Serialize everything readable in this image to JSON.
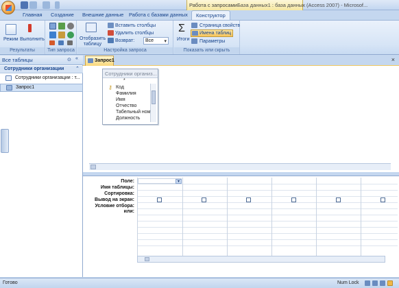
{
  "app": {
    "title": "База данных1 : база данных (Access 2007) - Microsof...",
    "context_tab_header": "Работа с запросами"
  },
  "tabs": [
    "Главная",
    "Создание",
    "Внешние данные",
    "Работа с базами данных",
    "Конструктор"
  ],
  "active_tab": "Конструктор",
  "ribbon": {
    "results": {
      "label": "Результаты",
      "view": "Режим",
      "run": "Выполнить"
    },
    "query_type": {
      "label": "Тип запроса"
    },
    "query_setup": {
      "label": "Настройка запроса",
      "show_table": "Отобразить таблицу",
      "insert_columns": "Вставить столбцы",
      "delete_columns": "Удалить столбцы",
      "return_label": "Возврат:",
      "return_value": "Все"
    },
    "show_hide": {
      "label": "Показать или скрыть",
      "totals": "Итоги",
      "property_sheet": "Страница свойств",
      "table_names": "Имена таблиц",
      "parameters": "Параметры"
    }
  },
  "nav": {
    "header": "Все таблицы",
    "group": "Сотрудники организации",
    "items": [
      "Сотрудники организации : т...",
      "Запрос1"
    ]
  },
  "document": {
    "tab": "Запрос1",
    "table_box": {
      "title": "Сотрудники организ...",
      "fields": [
        "*",
        "Код",
        "Фамилия",
        "Имя",
        "Отчество",
        "Табельный номе",
        "Должность"
      ]
    }
  },
  "grid": {
    "rows": [
      "Поле:",
      "Имя таблицы:",
      "Сортировка:",
      "Вывод на экран:",
      "Условие отбора:",
      "или:"
    ]
  },
  "status": {
    "left": "Готово",
    "num_lock": "Num Lock"
  }
}
